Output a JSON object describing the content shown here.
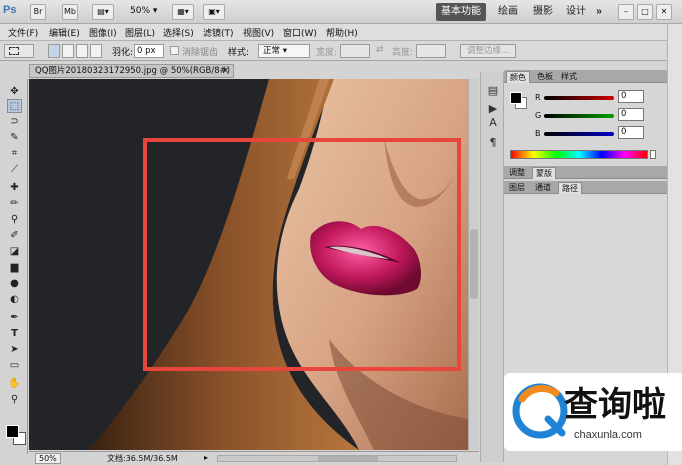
{
  "app": {
    "logo": "Ps",
    "toolbar": {
      "bridge": "Br",
      "mini": "Mb",
      "zoom": "50%"
    },
    "workspaces": [
      "基本功能",
      "绘画",
      "摄影",
      "设计"
    ],
    "more_glyph": "»"
  },
  "menu": [
    "文件(F)",
    "编辑(E)",
    "图像(I)",
    "图层(L)",
    "选择(S)",
    "滤镜(T)",
    "视图(V)",
    "窗口(W)",
    "帮助(H)"
  ],
  "options": {
    "feather_label": "羽化:",
    "feather_value": "0 px",
    "antialias_label": "消除锯齿",
    "style_label": "样式:",
    "style_value": "正常",
    "width_label": "宽度:",
    "height_label": "高度:",
    "refine_edge": "调整边缘..."
  },
  "document": {
    "tab_title": "QQ图片20180323172950.jpg @ 50%(RGB/8#) *",
    "close_glyph": "×",
    "zoom": "50%",
    "doc_info": "文档:36.5M/36.5M"
  },
  "panels": {
    "color_tabs": [
      "颜色",
      "色板",
      "样式"
    ],
    "channels": [
      {
        "label": "R",
        "value": "0",
        "color": "#d00000"
      },
      {
        "label": "G",
        "value": "0",
        "color": "#00a000"
      },
      {
        "label": "B",
        "value": "0",
        "color": "#0000c8"
      }
    ],
    "adjust_tabs": [
      "调整",
      "蒙版"
    ],
    "layer_tabs": [
      "图层",
      "通道",
      "路径"
    ]
  },
  "watermark": {
    "brand_cn": "查询啦",
    "brand_en": "chaxunla.com",
    "accent_orange": "#f28a1e",
    "accent_blue": "#1f84d6"
  },
  "colors": {
    "selection_border": "#e8453c",
    "lips": "#c2185b"
  }
}
